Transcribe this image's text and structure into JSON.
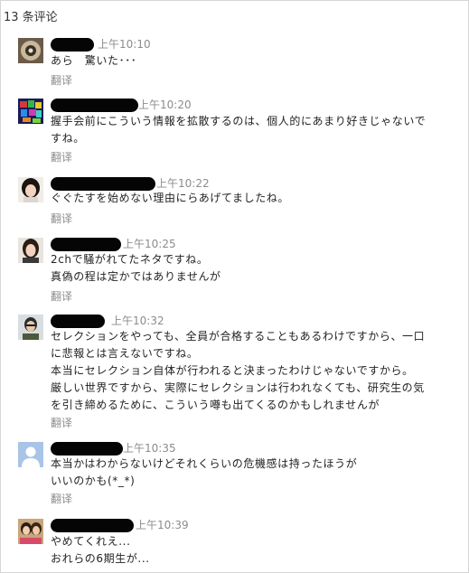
{
  "header": {
    "count_label": "13 条评论"
  },
  "translate_label": "翻译",
  "comments": [
    {
      "time": "上午10:10",
      "lines": [
        "あら　驚いた･･･"
      ]
    },
    {
      "time": "上午10:20",
      "lines": [
        "握手会前にこういう情報を拡散するのは、個人的にあまり好きじゃないで",
        "すね。"
      ]
    },
    {
      "time": "上午10:22",
      "lines": [
        "ぐぐたすを始めない理由にらあげてましたね。"
      ]
    },
    {
      "time": "上午10:25",
      "lines": [
        "2chで騒がれてたネタですね。",
        "真偽の程は定かではありませんが"
      ]
    },
    {
      "time": "上午10:32",
      "lines": [
        "セレクションをやっても、全員が合格することもあるわけですから、一口",
        "に悲報とは言えないですね。",
        "本当にセレクション自体が行われると決まったわけじゃないですから。",
        "厳しい世界ですから、実際にセレクションは行われなくても、研究生の気",
        "を引き締めるために、こういう噂も出てくるのかもしれませんが"
      ]
    },
    {
      "time": "上午10:35",
      "lines": [
        "本当かはわからないけどそれくらいの危機感は持ったほうが",
        "いいのかも(*_*)"
      ]
    },
    {
      "time": "上午10:39",
      "lines": [
        "やめてくれえ...",
        "おれらの6期生が..."
      ]
    }
  ]
}
